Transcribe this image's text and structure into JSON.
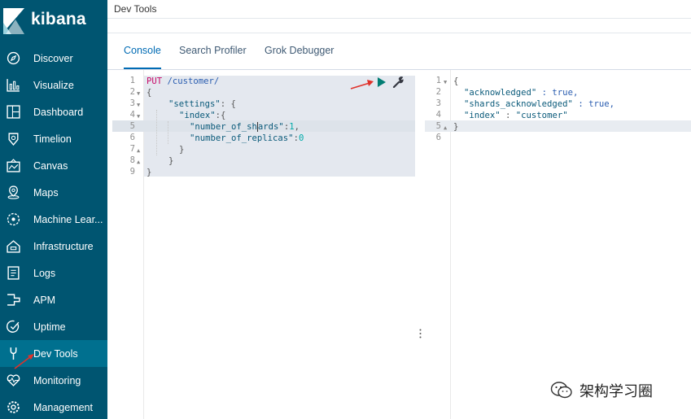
{
  "app": {
    "brand": "kibana"
  },
  "sidebar": {
    "items": [
      {
        "label": "Discover",
        "icon": "compass-icon"
      },
      {
        "label": "Visualize",
        "icon": "chart-icon"
      },
      {
        "label": "Dashboard",
        "icon": "dashboard-icon"
      },
      {
        "label": "Timelion",
        "icon": "timelion-icon"
      },
      {
        "label": "Canvas",
        "icon": "canvas-icon"
      },
      {
        "label": "Maps",
        "icon": "map-pin-icon"
      },
      {
        "label": "Machine Lear...",
        "icon": "machine-learning-icon"
      },
      {
        "label": "Infrastructure",
        "icon": "infrastructure-icon"
      },
      {
        "label": "Logs",
        "icon": "logs-icon"
      },
      {
        "label": "APM",
        "icon": "apm-icon"
      },
      {
        "label": "Uptime",
        "icon": "uptime-icon"
      },
      {
        "label": "Dev Tools",
        "icon": "wrench-icon",
        "active": true
      },
      {
        "label": "Monitoring",
        "icon": "heartbeat-icon"
      },
      {
        "label": "Management",
        "icon": "gear-icon"
      }
    ]
  },
  "header": {
    "title": "Dev Tools"
  },
  "tabs": [
    {
      "label": "Console",
      "active": true
    },
    {
      "label": "Search Profiler"
    },
    {
      "label": "Grok Debugger"
    }
  ],
  "request": {
    "line_numbers": [
      "1",
      "2",
      "3",
      "4",
      "5",
      "6",
      "7",
      "8",
      "9"
    ],
    "method": "PUT",
    "path": "/customer/",
    "l2": "{",
    "l3_key": "\"settings\"",
    "l3_rest": ": {",
    "l4_key": "\"index\"",
    "l4_rest": ":{",
    "l5_key_a": "\"number_of_sh",
    "l5_key_b": "ards\"",
    "l5_colon": ":",
    "l5_val": "1",
    "l5_comma": ",",
    "l6_key": "\"number_of_replicas\"",
    "l6_colon": ":",
    "l6_val": "0",
    "l7": "}",
    "l8": "}",
    "l9": "}"
  },
  "response": {
    "line_numbers": [
      "1",
      "2",
      "3",
      "4",
      "5",
      "6"
    ],
    "l1": "{",
    "l2_key": "\"acknowledged\"",
    "l2_rest": " : true,",
    "l3_key": "\"shards_acknowledged\"",
    "l3_rest": " : true,",
    "l4_key": "\"index\"",
    "l4_sep": " : ",
    "l4_val": "\"customer\"",
    "l5": "}"
  },
  "watermark": {
    "text": "架构学习圈"
  },
  "colors": {
    "sidebar": "#005571",
    "sidebar_active": "#00708f",
    "accent": "#006bb4",
    "run": "#017d73",
    "arrow": "#e0312a"
  }
}
